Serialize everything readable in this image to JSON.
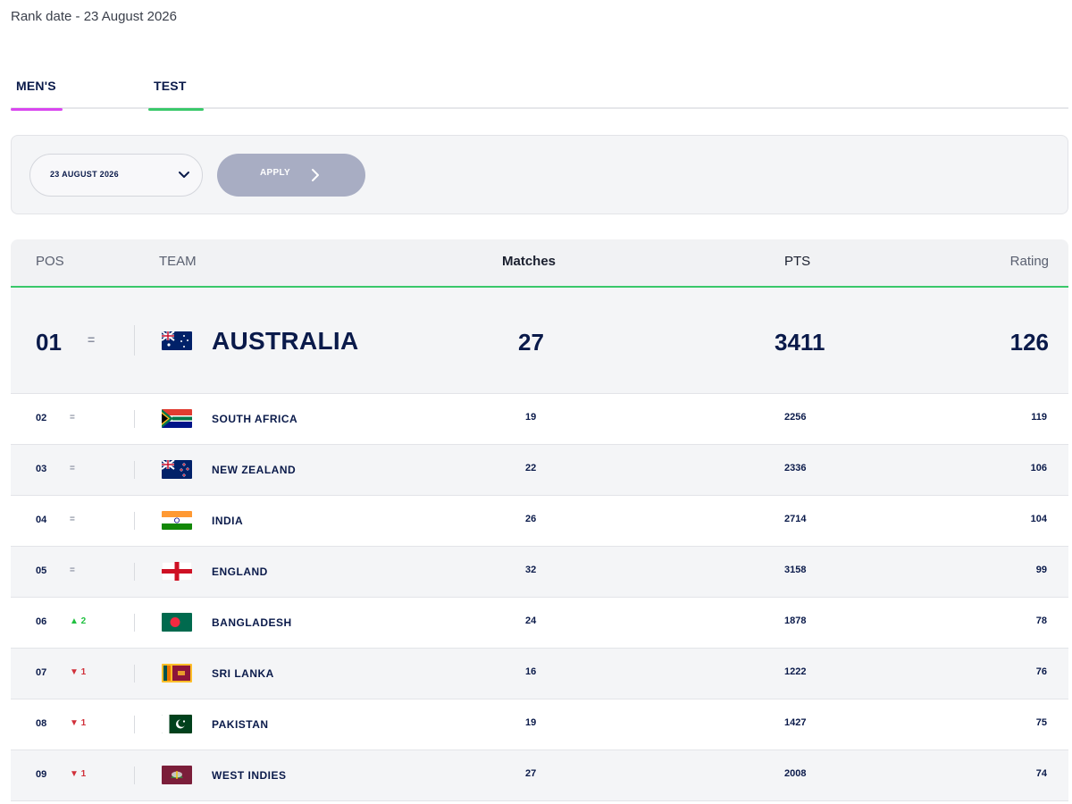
{
  "header": {
    "rank_date": "Rank date - 23 August 2026"
  },
  "tabs": [
    {
      "label": "MEN'S",
      "accent": "#d946ef"
    },
    {
      "label": "TEST",
      "accent": "#3ac86a"
    }
  ],
  "filter": {
    "date_value": "23 AUGUST 2026",
    "apply_label": "APPLY"
  },
  "table": {
    "headers": {
      "pos": "POS",
      "team": "TEAM",
      "matches": "Matches",
      "pts": "PTS",
      "rating": "Rating"
    },
    "rows": [
      {
        "pos": "01",
        "movement": "=",
        "trend": "same",
        "team": "AUSTRALIA",
        "matches": "27",
        "pts": "3411",
        "rating": "126",
        "flag": "australia-flag-icon"
      },
      {
        "pos": "02",
        "movement": "=",
        "trend": "same",
        "team": "SOUTH AFRICA",
        "matches": "19",
        "pts": "2256",
        "rating": "119",
        "flag": "south-africa-flag-icon"
      },
      {
        "pos": "03",
        "movement": "=",
        "trend": "same",
        "team": "NEW ZEALAND",
        "matches": "22",
        "pts": "2336",
        "rating": "106",
        "flag": "new-zealand-flag-icon"
      },
      {
        "pos": "04",
        "movement": "=",
        "trend": "same",
        "team": "INDIA",
        "matches": "26",
        "pts": "2714",
        "rating": "104",
        "flag": "india-flag-icon"
      },
      {
        "pos": "05",
        "movement": "=",
        "trend": "same",
        "team": "ENGLAND",
        "matches": "32",
        "pts": "3158",
        "rating": "99",
        "flag": "england-flag-icon"
      },
      {
        "pos": "06",
        "movement": "▲ 2",
        "trend": "up",
        "team": "BANGLADESH",
        "matches": "24",
        "pts": "1878",
        "rating": "78",
        "flag": "bangladesh-flag-icon"
      },
      {
        "pos": "07",
        "movement": "▼ 1",
        "trend": "down",
        "team": "SRI LANKA",
        "matches": "16",
        "pts": "1222",
        "rating": "76",
        "flag": "sri-lanka-flag-icon"
      },
      {
        "pos": "08",
        "movement": "▼ 1",
        "trend": "down",
        "team": "PAKISTAN",
        "matches": "19",
        "pts": "1427",
        "rating": "75",
        "flag": "pakistan-flag-icon"
      },
      {
        "pos": "09",
        "movement": "▼ 1",
        "trend": "down",
        "team": "WEST INDIES",
        "matches": "27",
        "pts": "2008",
        "rating": "74",
        "flag": "west-indies-flag-icon"
      }
    ]
  }
}
